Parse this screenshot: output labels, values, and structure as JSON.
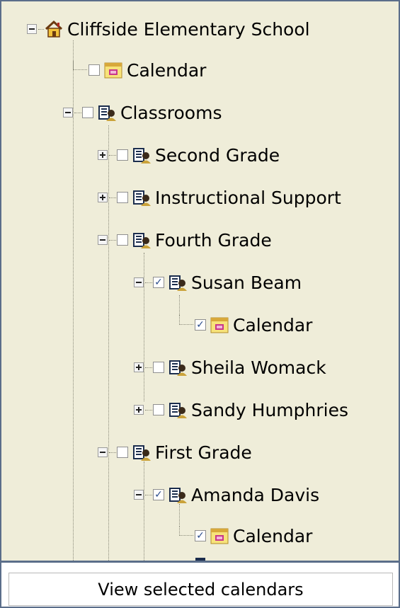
{
  "tree": {
    "root": {
      "label": "Cliffside Elementary School",
      "icon": "home-icon"
    },
    "school_calendar": {
      "label": "Calendar",
      "icon": "calendar-icon",
      "checked": false
    },
    "classrooms": {
      "label": "Classrooms",
      "icon": "classroom-icon",
      "checked": false
    },
    "second_grade": {
      "label": "Second Grade",
      "checked": false
    },
    "instructional_support": {
      "label": "Instructional Support",
      "checked": false
    },
    "fourth_grade": {
      "label": "Fourth Grade",
      "checked": false
    },
    "susan_beam": {
      "label": "Susan Beam",
      "checked": true
    },
    "susan_beam_calendar": {
      "label": "Calendar",
      "checked": true
    },
    "sheila_womack": {
      "label": "Sheila Womack",
      "checked": false
    },
    "sandy_humphries": {
      "label": "Sandy Humphries",
      "checked": false
    },
    "first_grade": {
      "label": "First Grade",
      "checked": false
    },
    "amanda_davis": {
      "label": "Amanda Davis",
      "checked": true
    },
    "amanda_davis_calendar": {
      "label": "Calendar",
      "checked": true
    }
  },
  "footer": {
    "view_button_label": "View selected calendars"
  },
  "colors": {
    "background": "#efedd9",
    "border": "#5b6e8a",
    "check": "#2a4c8c"
  }
}
